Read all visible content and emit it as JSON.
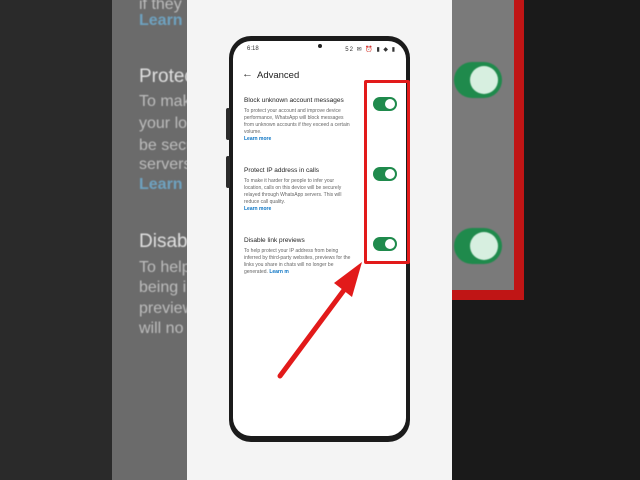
{
  "background": {
    "left_lines": [
      "if they",
      "Learn r",
      "Protec",
      "To mak",
      "your lo",
      "be secu",
      "servers",
      "Learn n",
      "Disabl",
      "To help",
      "being i",
      "preview",
      "will no"
    ]
  },
  "status_bar": {
    "time": "6:18",
    "indicators": "52 ✉ ⏰ ▮ ◆ ▮"
  },
  "app_bar": {
    "back_icon": "←",
    "title": "Advanced"
  },
  "settings": [
    {
      "title": "Block unknown account messages",
      "description": "To protect your account and improve device performance, WhatsApp will block messages from unknown accounts if they exceed a certain volume.",
      "link": "Learn more",
      "enabled": true
    },
    {
      "title": "Protect IP address in calls",
      "description": "To make it harder for people to infer your location, calls on this device will be securely relayed through WhatsApp servers. This will reduce call quality.",
      "link": "Learn more",
      "enabled": true
    },
    {
      "title": "Disable link previews",
      "description": "To help protect your IP address from being inferred by third-party websites, previews for the links you share in chats will no longer be generated.",
      "link": "Learn m",
      "enabled": true
    }
  ],
  "colors": {
    "toggle_on": "#1f8a4c",
    "highlight": "#e21a1a",
    "link": "#0b74c4"
  }
}
